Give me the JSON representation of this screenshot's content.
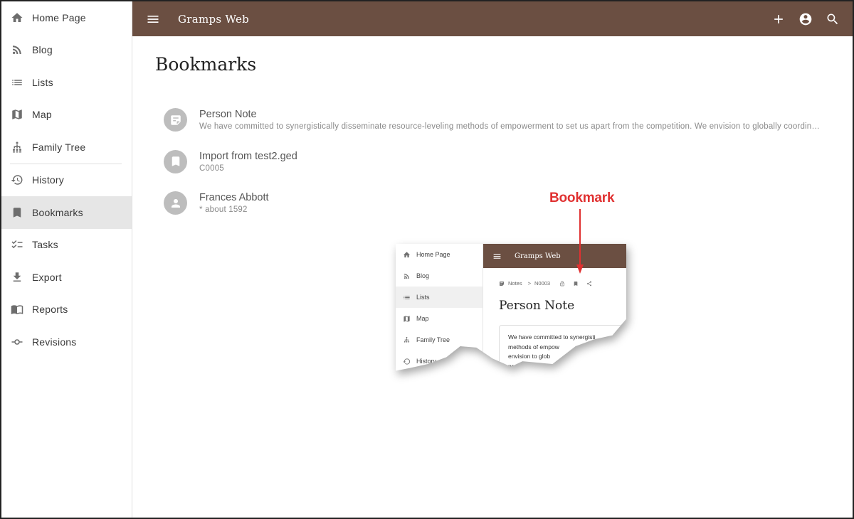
{
  "sidebar": {
    "items": [
      {
        "label": "Home Page",
        "icon": "home-icon"
      },
      {
        "label": "Blog",
        "icon": "rss-icon"
      },
      {
        "label": "Lists",
        "icon": "list-icon"
      },
      {
        "label": "Map",
        "icon": "map-icon"
      },
      {
        "label": "Family Tree",
        "icon": "family-tree-icon"
      },
      {
        "label": "History",
        "icon": "history-icon"
      },
      {
        "label": "Bookmarks",
        "icon": "bookmark-icon",
        "active": true
      },
      {
        "label": "Tasks",
        "icon": "checklist-icon"
      },
      {
        "label": "Export",
        "icon": "download-icon"
      },
      {
        "label": "Reports",
        "icon": "book-icon"
      },
      {
        "label": "Revisions",
        "icon": "commit-icon"
      }
    ]
  },
  "header": {
    "title": "Gramps Web",
    "actions": [
      "add-icon",
      "account-icon",
      "search-icon"
    ]
  },
  "main": {
    "title": "Bookmarks",
    "bookmarks": [
      {
        "icon": "note-icon",
        "primary": "Person Note",
        "secondary": "We have committed to synergistically disseminate resource-leveling methods of empowerment to set us apart from the competition. We envision to globally coordinate professional paradigms"
      },
      {
        "icon": "bookmark-icon",
        "primary": "Import from test2.ged",
        "secondary": "C0005"
      },
      {
        "icon": "person-icon",
        "primary": "Frances Abbott",
        "secondary": "* about 1592"
      }
    ]
  },
  "inset": {
    "sidebar_items": [
      "Home Page",
      "Blog",
      "Lists",
      "Map",
      "Family Tree",
      "History"
    ],
    "header_title": "Gramps Web",
    "breadcrumb": {
      "section": "Notes",
      "separator": ">",
      "id": "N0003"
    },
    "title": "Person Note",
    "card_lines": [
      "We have committed to synergisti",
      "methods of empow",
      "envision to glob",
      "professional"
    ]
  },
  "annotation": {
    "label": "Bookmark",
    "color": "#e03131"
  },
  "colors": {
    "brand_brown": "#6b4f42",
    "active_bg": "#e6e6e6",
    "avatar_gray": "#bdbdbd"
  }
}
